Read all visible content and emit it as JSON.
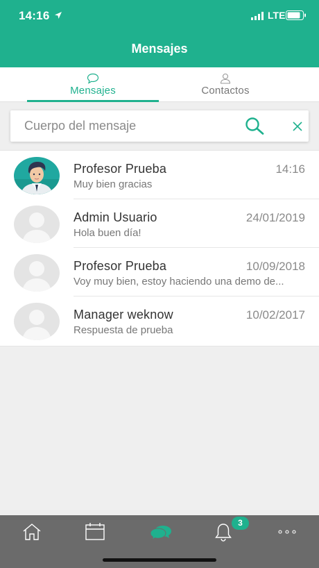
{
  "status_bar": {
    "time": "14:16",
    "carrier": "LTE"
  },
  "header": {
    "title": "Mensajes"
  },
  "tabs": [
    {
      "label": "Mensajes",
      "icon": "chat-bubble-icon",
      "active": true
    },
    {
      "label": "Contactos",
      "icon": "person-icon",
      "active": false
    }
  ],
  "search": {
    "placeholder": "Cuerpo del mensaje",
    "value": ""
  },
  "messages": [
    {
      "name": "Profesor Prueba",
      "date": "14:16",
      "preview": "Muy bien gracias",
      "avatar": "photo"
    },
    {
      "name": "Admin Usuario",
      "date": "24/01/2019",
      "preview": "Hola buen día!",
      "avatar": "placeholder"
    },
    {
      "name": "Profesor Prueba",
      "date": "10/09/2018",
      "preview": "Voy muy bien, estoy haciendo una demo de...",
      "avatar": "placeholder"
    },
    {
      "name": "Manager weknow",
      "date": "10/02/2017",
      "preview": "Respuesta de prueba",
      "avatar": "placeholder"
    }
  ],
  "bottom_nav": {
    "items": [
      "home-icon",
      "calendar-icon",
      "messages-icon",
      "bell-icon",
      "more-icon"
    ],
    "notifications_badge": "3",
    "active": "messages-icon"
  },
  "colors": {
    "accent": "#1fb18e",
    "nav_background": "#6b6b6b",
    "page_background": "#efefef"
  }
}
